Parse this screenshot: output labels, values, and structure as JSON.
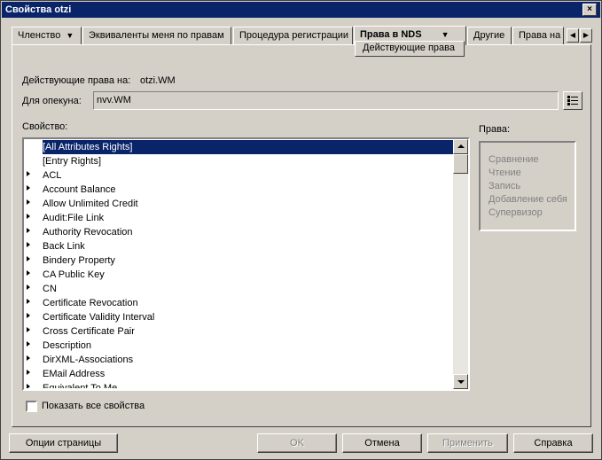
{
  "window": {
    "title": "Свойства  otzi",
    "close_glyph": "×"
  },
  "tabs": [
    {
      "label": "Членство",
      "has_dropdown": true
    },
    {
      "label": "Эквиваленты меня по правам"
    },
    {
      "label": "Процедура регистрации"
    },
    {
      "label": "Права в NDS",
      "has_dropdown": true,
      "active": true
    },
    {
      "label": "Другие"
    },
    {
      "label": "Права на"
    }
  ],
  "active_subtab": "Действующие права",
  "effective_rights": {
    "label": "Действующие права на:",
    "value": "otzi.WM"
  },
  "trustee": {
    "label": "Для опекуна:",
    "value": "nvv.WM"
  },
  "property_label": "Свойство:",
  "properties": [
    {
      "label": "[All Attributes Rights]",
      "selected": true,
      "expandable": false
    },
    {
      "label": "[Entry Rights]",
      "expandable": false
    },
    {
      "label": "ACL",
      "expandable": true
    },
    {
      "label": "Account Balance",
      "expandable": true
    },
    {
      "label": "Allow Unlimited Credit",
      "expandable": true
    },
    {
      "label": "Audit:File Link",
      "expandable": true
    },
    {
      "label": "Authority Revocation",
      "expandable": true
    },
    {
      "label": "Back Link",
      "expandable": true
    },
    {
      "label": "Bindery Property",
      "expandable": true
    },
    {
      "label": "CA Public Key",
      "expandable": true
    },
    {
      "label": "CN",
      "expandable": true
    },
    {
      "label": "Certificate Revocation",
      "expandable": true
    },
    {
      "label": "Certificate Validity Interval",
      "expandable": true
    },
    {
      "label": "Cross Certificate Pair",
      "expandable": true
    },
    {
      "label": "Description",
      "expandable": true
    },
    {
      "label": "DirXML-Associations",
      "expandable": true
    },
    {
      "label": "EMail Address",
      "expandable": true
    },
    {
      "label": "Equivalent To Me",
      "expandable": true
    }
  ],
  "rights": {
    "label": "Права:",
    "items": [
      "Сравнение",
      "Чтение",
      "Запись",
      "Добавление себя",
      "Супервизор"
    ]
  },
  "show_all_checkbox": {
    "label": "Показать все свойства",
    "checked": false
  },
  "buttons": {
    "page_options": "Опции страницы",
    "ok": "OK",
    "cancel": "Отмена",
    "apply": "Применить",
    "help": "Справка"
  },
  "colors": {
    "title_bar": "#0a246a",
    "selection": "#0a246a",
    "face": "#d4d0c8"
  }
}
